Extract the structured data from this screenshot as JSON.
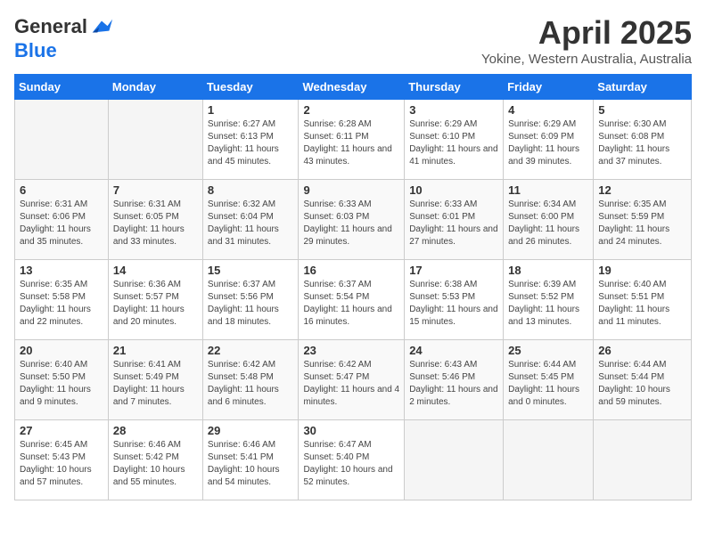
{
  "logo": {
    "general": "General",
    "blue": "Blue"
  },
  "title": "April 2025",
  "subtitle": "Yokine, Western Australia, Australia",
  "days_of_week": [
    "Sunday",
    "Monday",
    "Tuesday",
    "Wednesday",
    "Thursday",
    "Friday",
    "Saturday"
  ],
  "weeks": [
    [
      {
        "num": "",
        "sunrise": "",
        "sunset": "",
        "daylight": ""
      },
      {
        "num": "",
        "sunrise": "",
        "sunset": "",
        "daylight": ""
      },
      {
        "num": "1",
        "sunrise": "Sunrise: 6:27 AM",
        "sunset": "Sunset: 6:13 PM",
        "daylight": "Daylight: 11 hours and 45 minutes."
      },
      {
        "num": "2",
        "sunrise": "Sunrise: 6:28 AM",
        "sunset": "Sunset: 6:11 PM",
        "daylight": "Daylight: 11 hours and 43 minutes."
      },
      {
        "num": "3",
        "sunrise": "Sunrise: 6:29 AM",
        "sunset": "Sunset: 6:10 PM",
        "daylight": "Daylight: 11 hours and 41 minutes."
      },
      {
        "num": "4",
        "sunrise": "Sunrise: 6:29 AM",
        "sunset": "Sunset: 6:09 PM",
        "daylight": "Daylight: 11 hours and 39 minutes."
      },
      {
        "num": "5",
        "sunrise": "Sunrise: 6:30 AM",
        "sunset": "Sunset: 6:08 PM",
        "daylight": "Daylight: 11 hours and 37 minutes."
      }
    ],
    [
      {
        "num": "6",
        "sunrise": "Sunrise: 6:31 AM",
        "sunset": "Sunset: 6:06 PM",
        "daylight": "Daylight: 11 hours and 35 minutes."
      },
      {
        "num": "7",
        "sunrise": "Sunrise: 6:31 AM",
        "sunset": "Sunset: 6:05 PM",
        "daylight": "Daylight: 11 hours and 33 minutes."
      },
      {
        "num": "8",
        "sunrise": "Sunrise: 6:32 AM",
        "sunset": "Sunset: 6:04 PM",
        "daylight": "Daylight: 11 hours and 31 minutes."
      },
      {
        "num": "9",
        "sunrise": "Sunrise: 6:33 AM",
        "sunset": "Sunset: 6:03 PM",
        "daylight": "Daylight: 11 hours and 29 minutes."
      },
      {
        "num": "10",
        "sunrise": "Sunrise: 6:33 AM",
        "sunset": "Sunset: 6:01 PM",
        "daylight": "Daylight: 11 hours and 27 minutes."
      },
      {
        "num": "11",
        "sunrise": "Sunrise: 6:34 AM",
        "sunset": "Sunset: 6:00 PM",
        "daylight": "Daylight: 11 hours and 26 minutes."
      },
      {
        "num": "12",
        "sunrise": "Sunrise: 6:35 AM",
        "sunset": "Sunset: 5:59 PM",
        "daylight": "Daylight: 11 hours and 24 minutes."
      }
    ],
    [
      {
        "num": "13",
        "sunrise": "Sunrise: 6:35 AM",
        "sunset": "Sunset: 5:58 PM",
        "daylight": "Daylight: 11 hours and 22 minutes."
      },
      {
        "num": "14",
        "sunrise": "Sunrise: 6:36 AM",
        "sunset": "Sunset: 5:57 PM",
        "daylight": "Daylight: 11 hours and 20 minutes."
      },
      {
        "num": "15",
        "sunrise": "Sunrise: 6:37 AM",
        "sunset": "Sunset: 5:56 PM",
        "daylight": "Daylight: 11 hours and 18 minutes."
      },
      {
        "num": "16",
        "sunrise": "Sunrise: 6:37 AM",
        "sunset": "Sunset: 5:54 PM",
        "daylight": "Daylight: 11 hours and 16 minutes."
      },
      {
        "num": "17",
        "sunrise": "Sunrise: 6:38 AM",
        "sunset": "Sunset: 5:53 PM",
        "daylight": "Daylight: 11 hours and 15 minutes."
      },
      {
        "num": "18",
        "sunrise": "Sunrise: 6:39 AM",
        "sunset": "Sunset: 5:52 PM",
        "daylight": "Daylight: 11 hours and 13 minutes."
      },
      {
        "num": "19",
        "sunrise": "Sunrise: 6:40 AM",
        "sunset": "Sunset: 5:51 PM",
        "daylight": "Daylight: 11 hours and 11 minutes."
      }
    ],
    [
      {
        "num": "20",
        "sunrise": "Sunrise: 6:40 AM",
        "sunset": "Sunset: 5:50 PM",
        "daylight": "Daylight: 11 hours and 9 minutes."
      },
      {
        "num": "21",
        "sunrise": "Sunrise: 6:41 AM",
        "sunset": "Sunset: 5:49 PM",
        "daylight": "Daylight: 11 hours and 7 minutes."
      },
      {
        "num": "22",
        "sunrise": "Sunrise: 6:42 AM",
        "sunset": "Sunset: 5:48 PM",
        "daylight": "Daylight: 11 hours and 6 minutes."
      },
      {
        "num": "23",
        "sunrise": "Sunrise: 6:42 AM",
        "sunset": "Sunset: 5:47 PM",
        "daylight": "Daylight: 11 hours and 4 minutes."
      },
      {
        "num": "24",
        "sunrise": "Sunrise: 6:43 AM",
        "sunset": "Sunset: 5:46 PM",
        "daylight": "Daylight: 11 hours and 2 minutes."
      },
      {
        "num": "25",
        "sunrise": "Sunrise: 6:44 AM",
        "sunset": "Sunset: 5:45 PM",
        "daylight": "Daylight: 11 hours and 0 minutes."
      },
      {
        "num": "26",
        "sunrise": "Sunrise: 6:44 AM",
        "sunset": "Sunset: 5:44 PM",
        "daylight": "Daylight: 10 hours and 59 minutes."
      }
    ],
    [
      {
        "num": "27",
        "sunrise": "Sunrise: 6:45 AM",
        "sunset": "Sunset: 5:43 PM",
        "daylight": "Daylight: 10 hours and 57 minutes."
      },
      {
        "num": "28",
        "sunrise": "Sunrise: 6:46 AM",
        "sunset": "Sunset: 5:42 PM",
        "daylight": "Daylight: 10 hours and 55 minutes."
      },
      {
        "num": "29",
        "sunrise": "Sunrise: 6:46 AM",
        "sunset": "Sunset: 5:41 PM",
        "daylight": "Daylight: 10 hours and 54 minutes."
      },
      {
        "num": "30",
        "sunrise": "Sunrise: 6:47 AM",
        "sunset": "Sunset: 5:40 PM",
        "daylight": "Daylight: 10 hours and 52 minutes."
      },
      {
        "num": "",
        "sunrise": "",
        "sunset": "",
        "daylight": ""
      },
      {
        "num": "",
        "sunrise": "",
        "sunset": "",
        "daylight": ""
      },
      {
        "num": "",
        "sunrise": "",
        "sunset": "",
        "daylight": ""
      }
    ]
  ]
}
